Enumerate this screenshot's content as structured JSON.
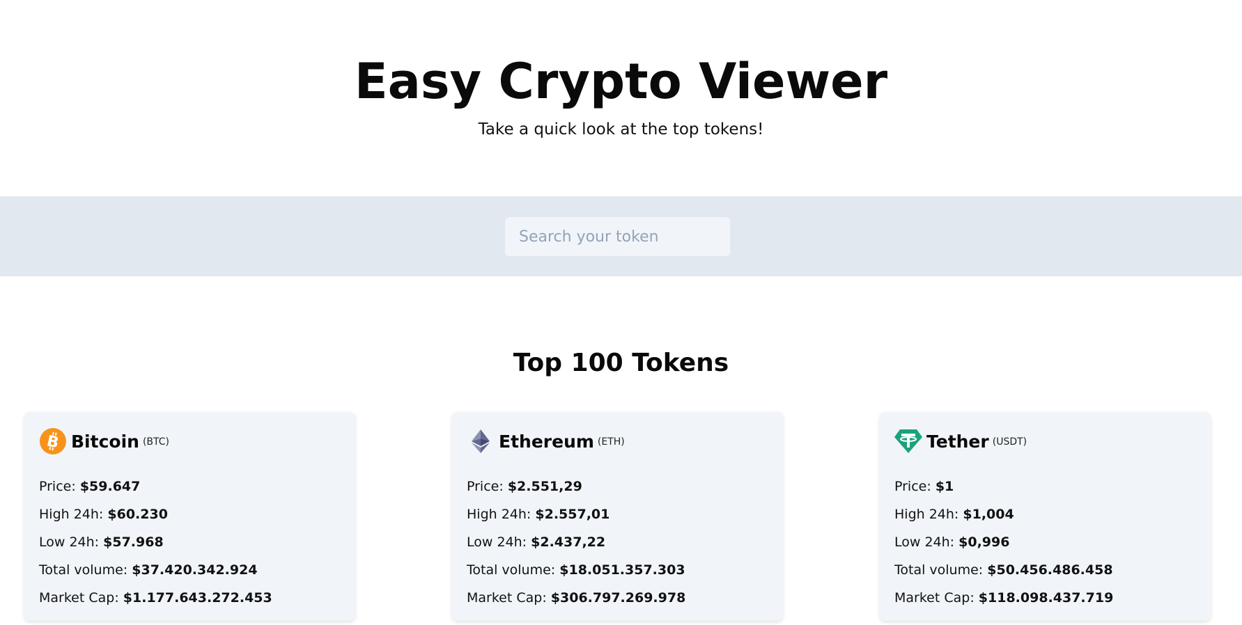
{
  "header": {
    "title": "Easy Crypto Viewer",
    "subtitle": "Take a quick look at the top tokens!"
  },
  "search": {
    "placeholder": "Search your token",
    "value": ""
  },
  "section": {
    "title": "Top 100 Tokens"
  },
  "colors": {
    "search_band": "#e2e8f0",
    "card_bg": "#f1f5f9",
    "bitcoin": "#f7931a",
    "ethereum": "#627eea",
    "tether": "#26a17b"
  },
  "cards": [
    {
      "icon": "bitcoin-icon",
      "name": "Bitcoin",
      "symbol": "(BTC)",
      "price_label": "Price:",
      "price": "$59.647",
      "high_label": "High 24h:",
      "high": "$60.230",
      "low_label": "Low 24h:",
      "low": "$57.968",
      "volume_label": "Total volume:",
      "volume": "$37.420.342.924",
      "cap_label": "Market Cap:",
      "cap": "$1.177.643.272.453"
    },
    {
      "icon": "ethereum-icon",
      "name": "Ethereum",
      "symbol": "(ETH)",
      "price_label": "Price:",
      "price": "$2.551,29",
      "high_label": "High 24h:",
      "high": "$2.557,01",
      "low_label": "Low 24h:",
      "low": "$2.437,22",
      "volume_label": "Total volume:",
      "volume": "$18.051.357.303",
      "cap_label": "Market Cap:",
      "cap": "$306.797.269.978"
    },
    {
      "icon": "tether-icon",
      "name": "Tether",
      "symbol": "(USDT)",
      "price_label": "Price:",
      "price": "$1",
      "high_label": "High 24h:",
      "high": "$1,004",
      "low_label": "Low 24h:",
      "low": "$0,996",
      "volume_label": "Total volume:",
      "volume": "$50.456.486.458",
      "cap_label": "Market Cap:",
      "cap": "$118.098.437.719"
    }
  ]
}
